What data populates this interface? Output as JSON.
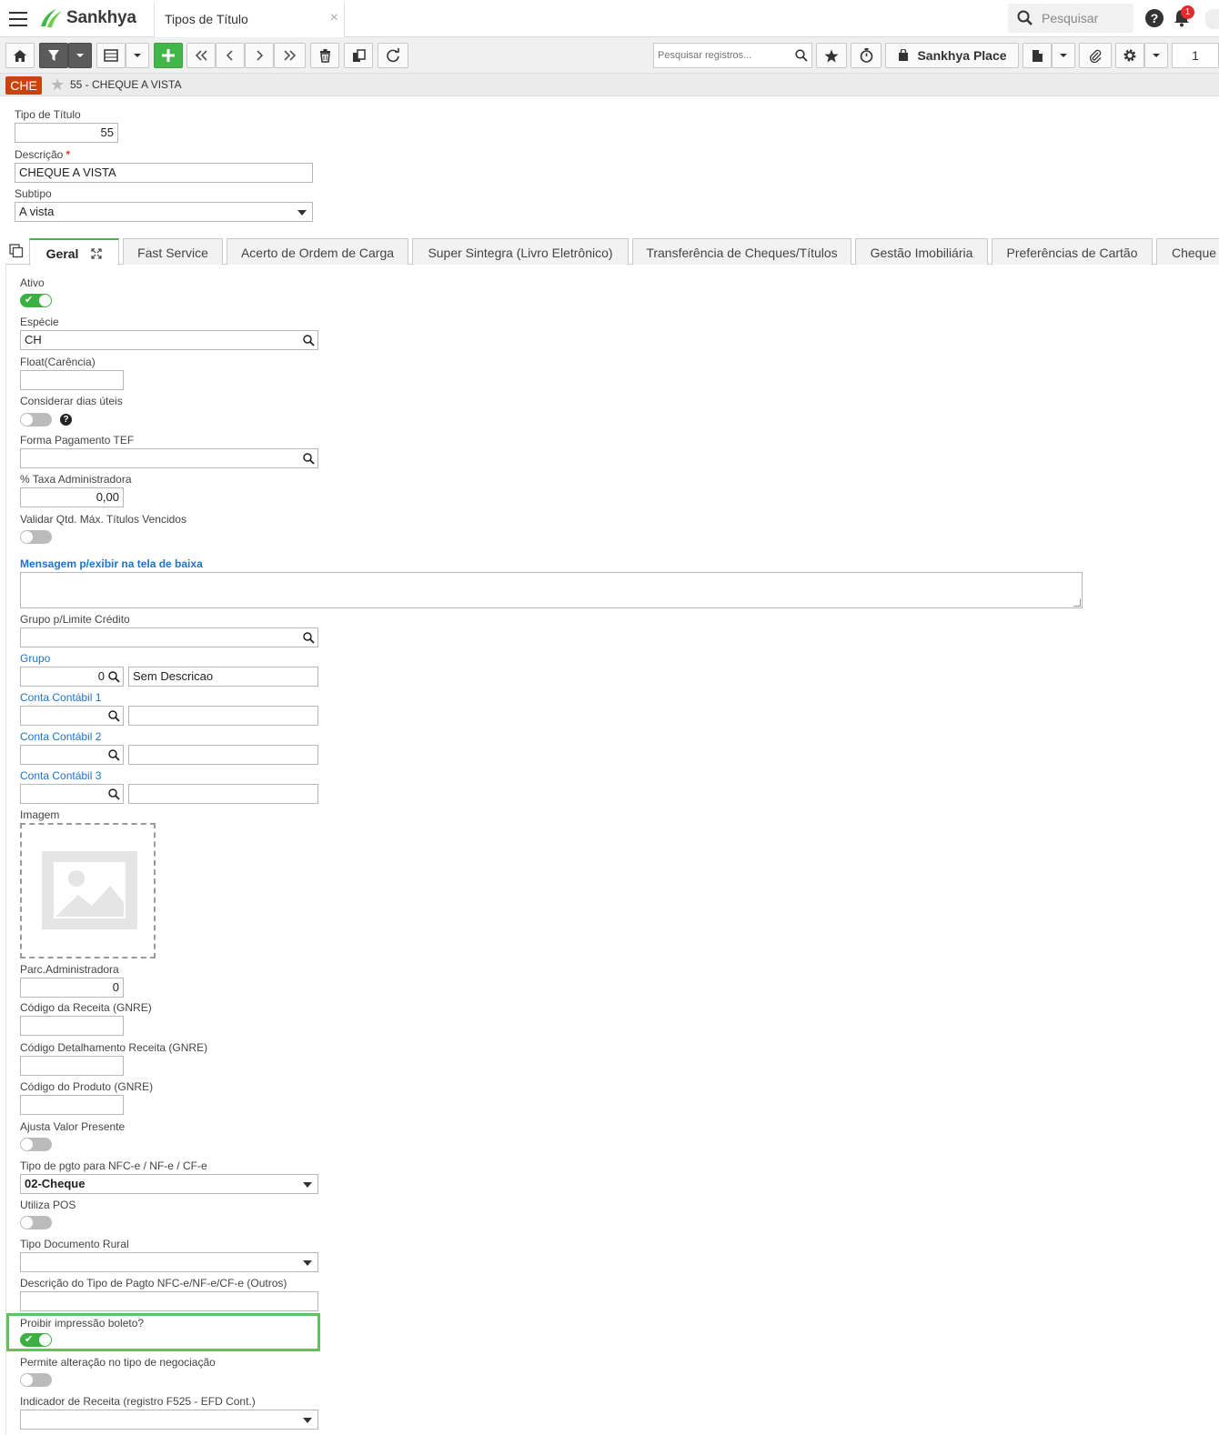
{
  "header": {
    "logo_text": "Sankhya",
    "app_tab_label": "Tipos de Título",
    "app_tab_close": "×",
    "search_placeholder": "Pesquisar",
    "help_label": "?",
    "notification_count": "1"
  },
  "toolbar": {
    "search_placeholder": "Pesquisar registros...",
    "place_label": "Sankhya Place",
    "page_number": "1"
  },
  "record": {
    "badge": "CHE",
    "title": "55 - CHEQUE A VISTA"
  },
  "form": {
    "tipo_titulo_label": "Tipo de Título",
    "tipo_titulo_value": "55",
    "descricao_label": "Descrição",
    "required_mark": "*",
    "descricao_value": "CHEQUE A VISTA",
    "subtipo_label": "Subtipo",
    "subtipo_value": "A vista"
  },
  "tabs": [
    {
      "label": "Geral"
    },
    {
      "label": "Fast Service"
    },
    {
      "label": "Acerto de Ordem de Carga"
    },
    {
      "label": "Super Sintegra (Livro Eletrônico)"
    },
    {
      "label": "Transferência de Cheques/Títulos"
    },
    {
      "label": "Gestão Imobiliária"
    },
    {
      "label": "Preferências de Cartão"
    },
    {
      "label": "Cheque"
    }
  ],
  "geral": {
    "ativo_label": "Ativo",
    "ativo_on": true,
    "especie_label": "Espécie",
    "especie_value": "CH",
    "float_label": "Float(Carência)",
    "float_value": "",
    "dias_uteis_label": "Considerar dias úteis",
    "dias_uteis_on": false,
    "dias_uteis_help": "?",
    "forma_tef_label": "Forma Pagamento TEF",
    "forma_tef_value": "",
    "taxa_label": "% Taxa Administradora",
    "taxa_value": "0,00",
    "validar_label": "Validar Qtd. Máx. Títulos Vencidos",
    "validar_on": false,
    "mensagem_label": "Mensagem p/exibir na tela de baixa",
    "mensagem_value": "",
    "grupo_limite_label": "Grupo p/Limite Crédito",
    "grupo_limite_value": "",
    "grupo_label": "Grupo",
    "grupo_code": "0",
    "grupo_desc": "Sem Descricao",
    "conta1_label": "Conta Contábil 1",
    "conta2_label": "Conta Contábil 2",
    "conta3_label": "Conta Contábil 3",
    "imagem_label": "Imagem",
    "parc_label": "Parc.Administradora",
    "parc_value": "0",
    "cod_receita_label": "Código da Receita (GNRE)",
    "cod_det_receita_label": "Código Detalhamento Receita (GNRE)",
    "cod_produto_label": "Código do Produto (GNRE)",
    "ajusta_label": "Ajusta Valor Presente",
    "ajusta_on": false,
    "tipo_pgto_label": "Tipo de pgto para NFC-e / NF-e / CF-e",
    "tipo_pgto_value": "02-Cheque",
    "utiliza_pos_label": "Utiliza POS",
    "utiliza_pos_on": false,
    "tipo_doc_rural_label": "Tipo Documento Rural",
    "tipo_doc_rural_value": "",
    "desc_tipo_pgto_label": "Descrição do Tipo de Pagto NFC-e/NF-e/CF-e (Outros)",
    "desc_tipo_pgto_value": "",
    "proibir_label": "Proibir impressão boleto?",
    "proibir_on": true,
    "permite_label": "Permite alteração no tipo de negociação",
    "permite_on": false,
    "indicador_label": "Indicador de Receita (registro F525 - EFD Cont.)",
    "indicador_value": ""
  },
  "colors": {
    "accent_green": "#43b649",
    "badge_orange": "#c9430c",
    "link_blue": "#1e73c8",
    "highlight_green": "#5ec25e"
  }
}
